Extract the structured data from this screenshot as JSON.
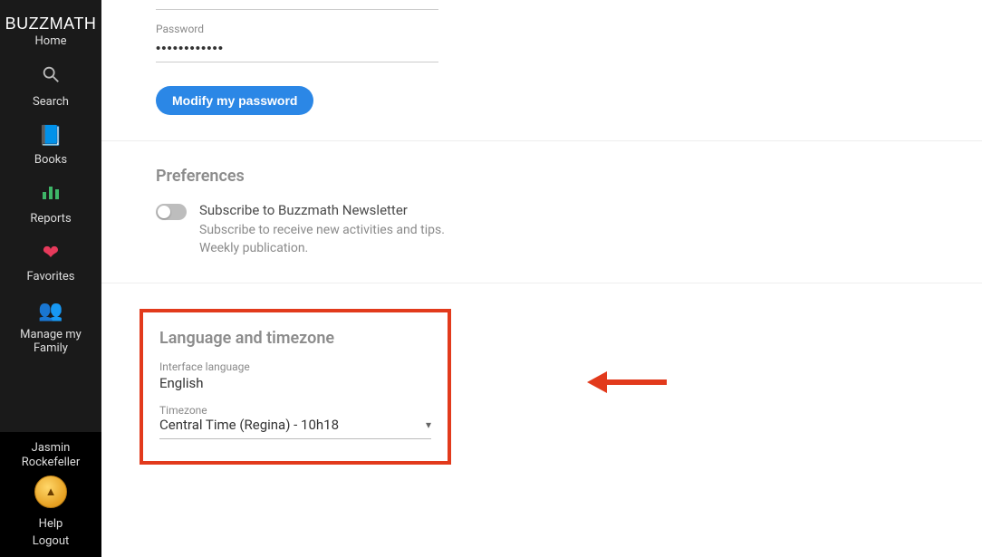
{
  "sidebar": {
    "logo": "BUZZMATH",
    "items": [
      {
        "label": "Home",
        "icon": "home-logo"
      },
      {
        "label": "Search",
        "icon": "search-icon"
      },
      {
        "label": "Books",
        "icon": "books-icon"
      },
      {
        "label": "Reports",
        "icon": "reports-icon"
      },
      {
        "label": "Favorites",
        "icon": "heart-icon"
      },
      {
        "label": "Manage my Family",
        "icon": "family-icon"
      }
    ],
    "user": {
      "first_name": "Jasmin",
      "last_name": "Rockefeller",
      "badge_glyph": "▲"
    },
    "footer": {
      "help_label": "Help",
      "logout_label": "Logout"
    }
  },
  "password_section": {
    "label": "Password",
    "value": "••••••••••••",
    "modify_button_label": "Modify my password"
  },
  "preferences": {
    "title": "Preferences",
    "newsletter": {
      "title": "Subscribe to Buzzmath Newsletter",
      "description": "Subscribe to receive new activities and tips. Weekly publication.",
      "enabled": false
    }
  },
  "language_tz": {
    "title": "Language and timezone",
    "language_label": "Interface language",
    "language_value": "English",
    "timezone_label": "Timezone",
    "timezone_value": "Central Time (Regina) - 10h18"
  },
  "annotations": {
    "highlight_color": "#e23a1c",
    "arrow_color": "#e23a1c"
  }
}
